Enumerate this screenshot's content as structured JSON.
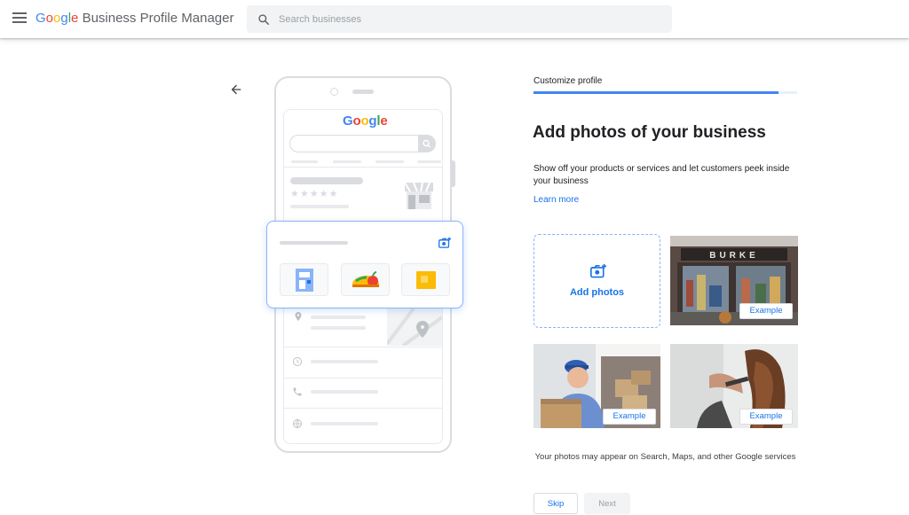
{
  "header": {
    "logo_google": [
      "G",
      "o",
      "o",
      "g",
      "l",
      "e"
    ],
    "logo_rest": "Business Profile Manager",
    "search": {
      "placeholder": "Search businesses",
      "value": ""
    }
  },
  "illustration": {
    "screen_logo": [
      "G",
      "o",
      "o",
      "g",
      "l",
      "e"
    ],
    "stars": "★★★★★"
  },
  "panel": {
    "step_label": "Customize profile",
    "progress_fraction": 0.93,
    "title": "Add photos of your business",
    "description": "Show off your products or services and let customers peek inside your business",
    "learn_more": "Learn more",
    "add_photos_label": "Add photos",
    "examples": [
      {
        "label": "Example"
      },
      {
        "label": "Example"
      },
      {
        "label": "Example"
      }
    ],
    "footnote": "Your photos may appear on Search, Maps, and other Google services",
    "skip_label": "Skip",
    "next_label": "Next"
  },
  "colors": {
    "accent": "#1a73e8",
    "progress": "#4285f4",
    "dashed_border": "#8ab4f8"
  },
  "icons": [
    "menu-icon",
    "search-icon",
    "back-arrow-icon",
    "add-photo-icon",
    "store-icon",
    "location-icon",
    "clock-icon",
    "phone-icon",
    "globe-icon"
  ]
}
